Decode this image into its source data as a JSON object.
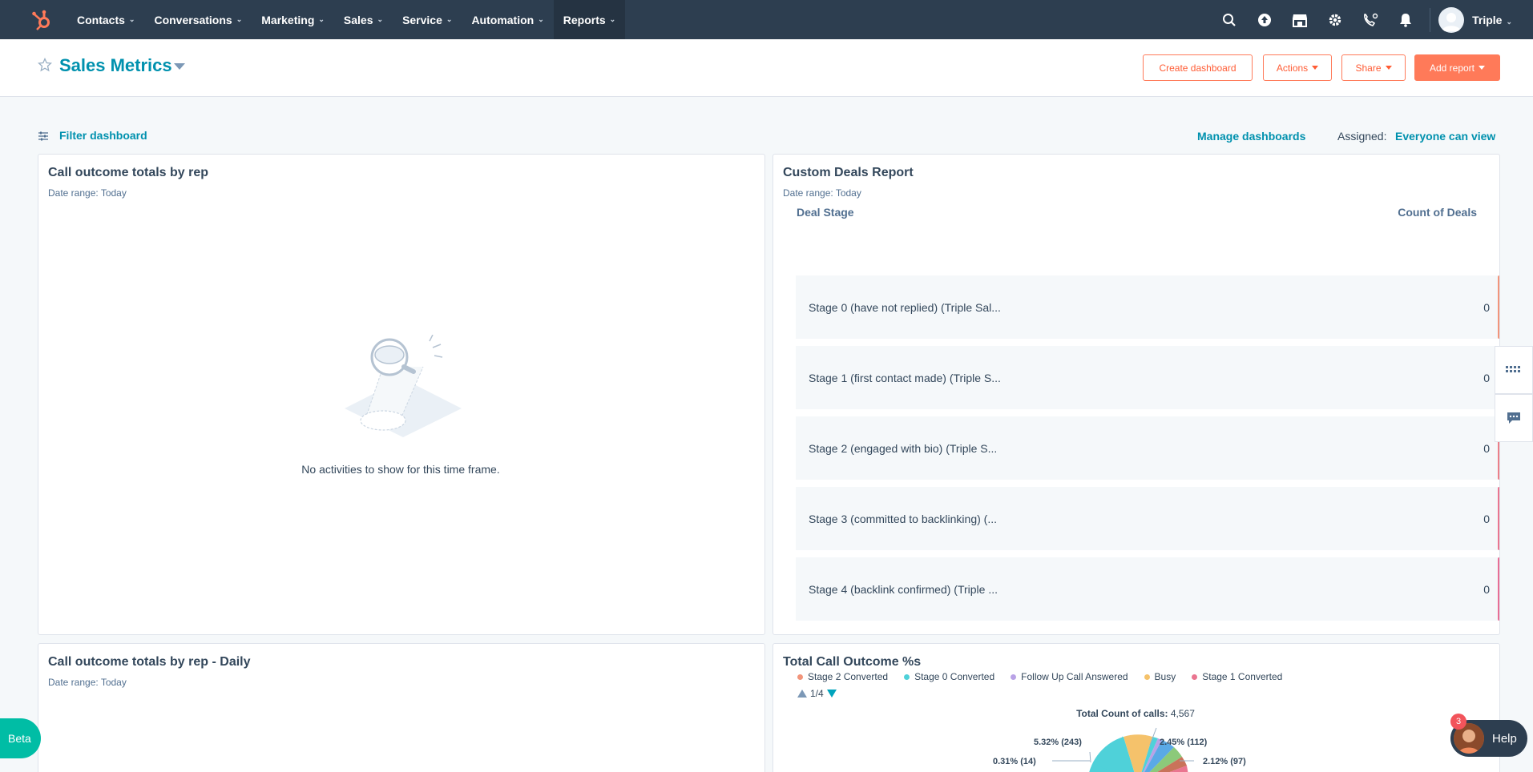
{
  "nav": {
    "items": [
      {
        "label": "Contacts"
      },
      {
        "label": "Conversations"
      },
      {
        "label": "Marketing"
      },
      {
        "label": "Sales"
      },
      {
        "label": "Service"
      },
      {
        "label": "Automation"
      },
      {
        "label": "Reports"
      }
    ],
    "user": "Triple"
  },
  "header": {
    "title": "Sales Metrics",
    "create_dashboard": "Create dashboard",
    "actions": "Actions",
    "share": "Share",
    "add_report": "Add report"
  },
  "filters": {
    "filter_label": "Filter dashboard",
    "manage_label": "Manage dashboards",
    "assigned_label": "Assigned:",
    "assigned_value": "Everyone can view"
  },
  "cards": {
    "call_outcome": {
      "title": "Call outcome totals by rep",
      "date_range": "Date range: Today",
      "empty_text": "No activities to show for this time frame."
    },
    "deals": {
      "title": "Custom Deals Report",
      "date_range": "Date range: Today",
      "col_stage": "Deal Stage",
      "col_count": "Count of Deals",
      "rows": [
        {
          "label": "Stage 0 (have not replied) (Triple Sal...",
          "count": "0",
          "color": "#f2957b"
        },
        {
          "label": "Stage 1 (first contact made) (Triple S...",
          "count": "0",
          "color": "#ef8a82"
        },
        {
          "label": "Stage 2 (engaged with bio) (Triple S...",
          "count": "0",
          "color": "#ec7f89"
        },
        {
          "label": "Stage 3 (committed to backlinking) (...",
          "count": "0",
          "color": "#ea7590"
        },
        {
          "label": "Stage 4 (backlink confirmed) (Triple ...",
          "count": "0",
          "color": "#e86e95"
        }
      ]
    },
    "call_daily": {
      "title": "Call outcome totals by rep - Daily",
      "date_range": "Date range: Today"
    },
    "total_outcome": {
      "title": "Total Call Outcome %s",
      "legend": [
        {
          "label": "Stage 2 Converted",
          "color": "#f2957b"
        },
        {
          "label": "Stage 0 Converted",
          "color": "#4fd1d9"
        },
        {
          "label": "Follow Up Call Answered",
          "color": "#b9a2e6"
        },
        {
          "label": "Busy",
          "color": "#f5c26b"
        },
        {
          "label": "Stage 1 Converted",
          "color": "#ea7590"
        }
      ],
      "pager": "1/4",
      "total_label": "Total Count of calls:",
      "total_value": "4,567",
      "pie_labels": [
        "5.32% (243)",
        "2.45% (112)",
        "0.31% (14)",
        "2.12% (97)"
      ]
    }
  },
  "widgets": {
    "beta": "Beta",
    "help": "Help",
    "help_badge": "3"
  },
  "colors": {
    "nav_bg": "#2d3e50",
    "accent": "#ff7a59",
    "link": "#0091ae"
  }
}
